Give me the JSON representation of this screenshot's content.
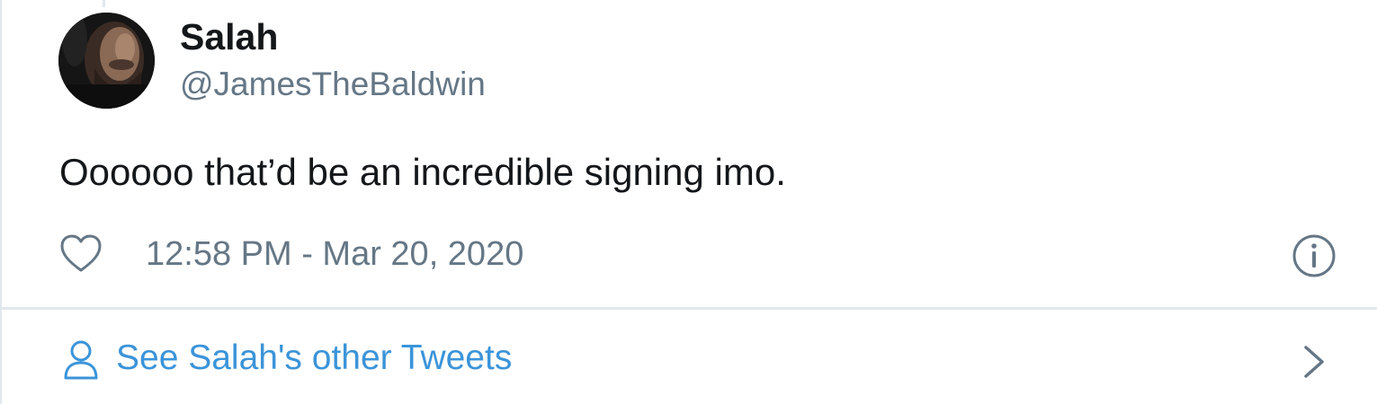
{
  "author": {
    "name": "Salah",
    "handle": "@JamesTheBaldwin",
    "avatar_icon": "user-photo-avatar"
  },
  "tweet": {
    "text": "Oooooo that’d be an incredible signing imo.",
    "timestamp": "12:58 PM - Mar 20, 2020"
  },
  "actions": {
    "like_icon": "heart-icon",
    "info_icon": "info-icon"
  },
  "footer": {
    "other_tweets_label": "See Salah's other Tweets",
    "user_icon": "user-icon",
    "chevron_icon": "chevron-right-icon"
  },
  "colors": {
    "text_primary": "#14171a",
    "text_secondary": "#657786",
    "link": "#3b94d9",
    "border": "#e1e8ed"
  }
}
